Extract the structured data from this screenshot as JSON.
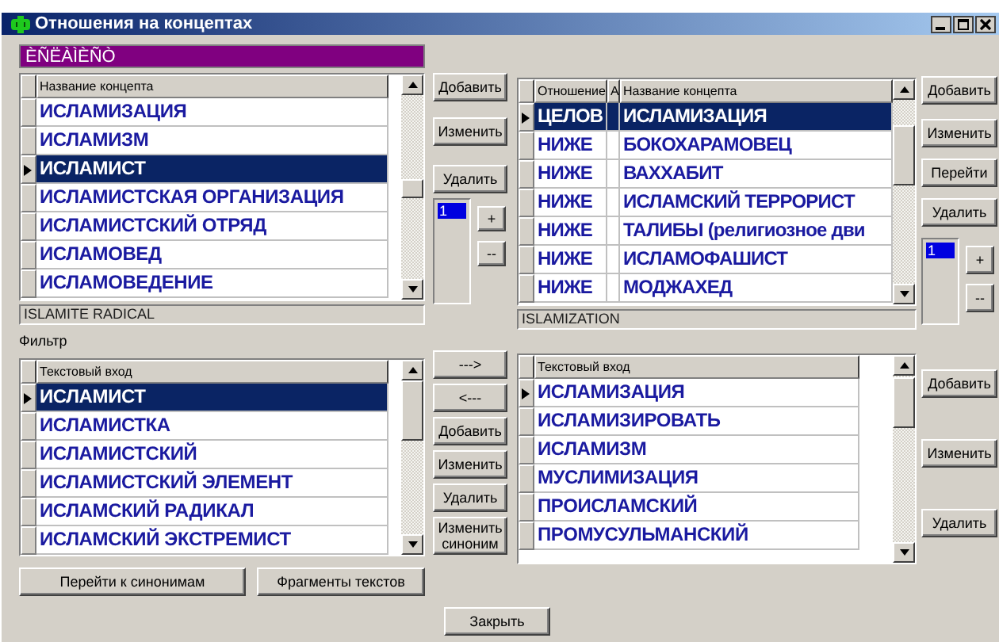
{
  "window": {
    "title": "Отношения на концептах"
  },
  "concept_banner": "ÈÑËÀÌÈÑÒ",
  "concepts": {
    "columns": [
      "Название концепта"
    ],
    "rows": [
      {
        "cells": [
          "ИСЛАМИЗАЦИЯ"
        ],
        "selected": false,
        "current": false
      },
      {
        "cells": [
          "ИСЛАМИЗМ"
        ],
        "selected": false,
        "current": false
      },
      {
        "cells": [
          "ИСЛАМИСТ"
        ],
        "selected": true,
        "current": true
      },
      {
        "cells": [
          "ИСЛАМИСТСКАЯ ОРГАНИЗАЦИЯ"
        ],
        "selected": false,
        "current": false
      },
      {
        "cells": [
          "ИСЛАМИСТСКИЙ ОТРЯД"
        ],
        "selected": false,
        "current": false
      },
      {
        "cells": [
          "ИСЛАМОВЕД"
        ],
        "selected": false,
        "current": false
      },
      {
        "cells": [
          "ИСЛАМОВЕДЕНИЕ"
        ],
        "selected": false,
        "current": false
      }
    ]
  },
  "concept_buttons": [
    "Добавить",
    "Изменить",
    "Удалить"
  ],
  "concept_list": {
    "items": [
      {
        "label": "1",
        "selected": true
      }
    ],
    "buttons": [
      "+",
      "--"
    ]
  },
  "concept_status": "ISLAMITE RADICAL",
  "relations": {
    "columns": [
      "Отношение",
      "А",
      "Название концепта"
    ],
    "rows": [
      {
        "cells": [
          "ЦЕЛОВ",
          "",
          "ИСЛАМИЗАЦИЯ"
        ],
        "selected": true,
        "current": true
      },
      {
        "cells": [
          "НИЖЕ",
          "",
          "БОКОХАРАМОВЕЦ"
        ],
        "selected": false,
        "current": false
      },
      {
        "cells": [
          "НИЖЕ",
          "",
          "ВАХХАБИТ"
        ],
        "selected": false,
        "current": false
      },
      {
        "cells": [
          "НИЖЕ",
          "",
          "ИСЛАМСКИЙ ТЕРРОРИСТ"
        ],
        "selected": false,
        "current": false
      },
      {
        "cells": [
          "НИЖЕ",
          "",
          "ТАЛИБЫ (религиозное дви"
        ],
        "selected": false,
        "current": false
      },
      {
        "cells": [
          "НИЖЕ",
          "",
          "ИСЛАМОФАШИСТ"
        ],
        "selected": false,
        "current": false
      },
      {
        "cells": [
          "НИЖЕ",
          "",
          "МОДЖАХЕД"
        ],
        "selected": false,
        "current": false
      }
    ]
  },
  "relation_buttons": [
    "Добавить",
    "Изменить",
    "Перейти",
    "Удалить"
  ],
  "relation_list": {
    "items": [
      {
        "label": "1",
        "selected": true
      }
    ],
    "buttons": [
      "+",
      "--"
    ]
  },
  "relation_status": "ISLAMIZATION",
  "filter_label": "Фильтр",
  "text_entries": {
    "columns": [
      "Текстовый вход"
    ],
    "rows": [
      {
        "cells": [
          "ИСЛАМИСТ"
        ],
        "selected": true,
        "current": true
      },
      {
        "cells": [
          "ИСЛАМИСТКА"
        ],
        "selected": false,
        "current": false
      },
      {
        "cells": [
          "ИСЛАМИСТСКИЙ"
        ],
        "selected": false,
        "current": false
      },
      {
        "cells": [
          "ИСЛАМИСТСКИЙ ЭЛЕМЕНТ"
        ],
        "selected": false,
        "current": false
      },
      {
        "cells": [
          "ИСЛАМСКИЙ РАДИКАЛ"
        ],
        "selected": false,
        "current": false
      },
      {
        "cells": [
          "ИСЛАМСКИЙ ЭКСТРЕМИСТ"
        ],
        "selected": false,
        "current": false
      }
    ]
  },
  "transfer_buttons": [
    "--->",
    "<---",
    "Добавить",
    "Изменить",
    "Удалить",
    "Изменить синоним"
  ],
  "synonym_entries": {
    "columns": [
      "Текстовый вход"
    ],
    "rows": [
      {
        "cells": [
          "ИСЛАМИЗАЦИЯ"
        ],
        "selected": false,
        "current": true
      },
      {
        "cells": [
          "ИСЛАМИЗИРОВАТЬ"
        ],
        "selected": false,
        "current": false
      },
      {
        "cells": [
          "ИСЛАМИЗМ"
        ],
        "selected": false,
        "current": false
      },
      {
        "cells": [
          "МУСЛИМИЗАЦИЯ"
        ],
        "selected": false,
        "current": false
      },
      {
        "cells": [
          "ПРОИСЛАМСКИЙ"
        ],
        "selected": false,
        "current": false
      },
      {
        "cells": [
          "ПРОМУСУЛЬМАНСКИЙ"
        ],
        "selected": false,
        "current": false
      }
    ]
  },
  "synonym_buttons": [
    "Добавить",
    "Изменить",
    "Удалить"
  ],
  "bottom_buttons": [
    "Перейти к синонимам",
    "Фрагменты текстов"
  ],
  "close_button": "Закрыть"
}
